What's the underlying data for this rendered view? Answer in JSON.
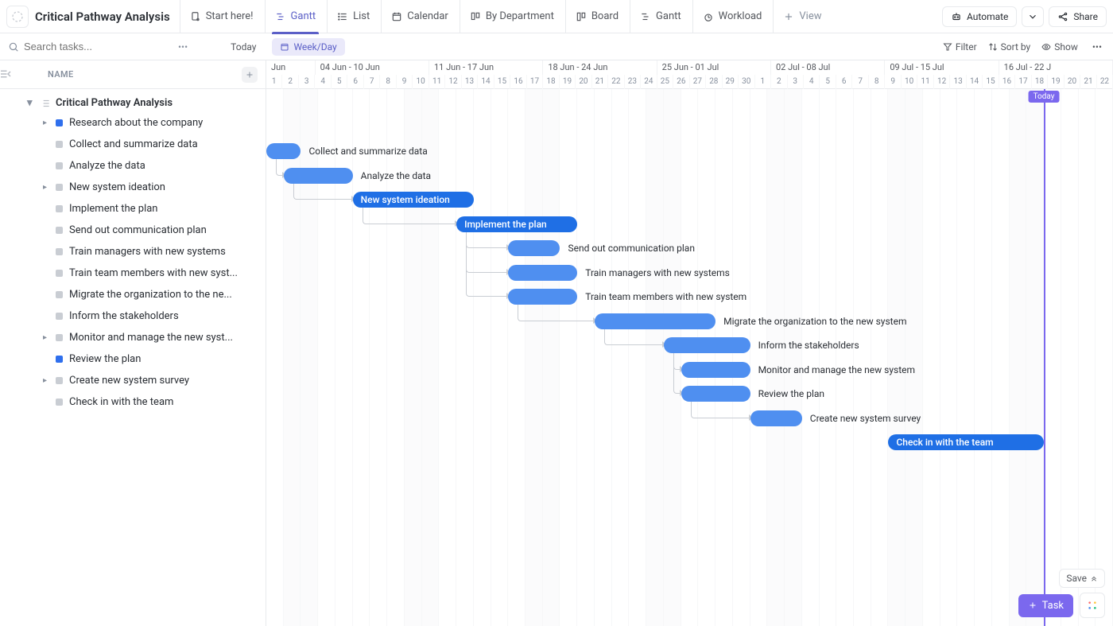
{
  "header": {
    "title": "Critical Pathway Analysis",
    "tabs": [
      {
        "label": "Start here!"
      },
      {
        "label": "Gantt"
      },
      {
        "label": "List"
      },
      {
        "label": "Calendar"
      },
      {
        "label": "By Department"
      },
      {
        "label": "Board"
      },
      {
        "label": "Gantt"
      },
      {
        "label": "Workload"
      }
    ],
    "add_view": "View",
    "automate": "Automate",
    "share": "Share"
  },
  "filter": {
    "search_placeholder": "Search tasks...",
    "today": "Today",
    "weekday": "Week/Day",
    "filter": "Filter",
    "sortby": "Sort by",
    "show": "Show"
  },
  "sidebar": {
    "name_header": "NAME",
    "group": "Critical Pathway Analysis",
    "tasks": [
      {
        "label": "Research about the company",
        "status": "blue",
        "children": true
      },
      {
        "label": "Collect and summarize data",
        "status": "grey",
        "children": false
      },
      {
        "label": "Analyze the data",
        "status": "grey",
        "children": false
      },
      {
        "label": "New system ideation",
        "status": "grey",
        "children": true
      },
      {
        "label": "Implement the plan",
        "status": "grey",
        "children": false
      },
      {
        "label": "Send out communication plan",
        "status": "grey",
        "children": false
      },
      {
        "label": "Train managers with new systems",
        "status": "grey",
        "children": false
      },
      {
        "label": "Train team members with new syst...",
        "status": "grey",
        "children": false
      },
      {
        "label": "Migrate the organization to the ne...",
        "status": "grey",
        "children": false
      },
      {
        "label": "Inform the stakeholders",
        "status": "grey",
        "children": false
      },
      {
        "label": "Monitor and manage the new syst...",
        "status": "grey",
        "children": true
      },
      {
        "label": "Review the plan",
        "status": "blue",
        "children": false
      },
      {
        "label": "Create new system survey",
        "status": "grey",
        "children": true
      },
      {
        "label": "Check in with the team",
        "status": "grey",
        "children": false
      }
    ]
  },
  "timeline": {
    "weeks": [
      {
        "label": "Jun",
        "days": 3
      },
      {
        "label": "04 Jun - 10 Jun",
        "days": 7
      },
      {
        "label": "11 Jun - 17 Jun",
        "days": 7
      },
      {
        "label": "18 Jun - 24 Jun",
        "days": 7
      },
      {
        "label": "25 Jun - 01 Jul",
        "days": 7
      },
      {
        "label": "02 Jul - 08 Jul",
        "days": 7
      },
      {
        "label": "09 Jul - 15 Jul",
        "days": 7
      },
      {
        "label": "16 Jul - 22 J",
        "days": 7
      }
    ],
    "days": [
      1,
      2,
      3,
      4,
      5,
      6,
      7,
      8,
      9,
      10,
      11,
      12,
      13,
      14,
      15,
      16,
      17,
      18,
      19,
      20,
      21,
      22,
      23,
      24,
      25,
      26,
      27,
      28,
      29,
      30,
      1,
      2,
      3,
      4,
      5,
      6,
      7,
      8,
      9,
      10,
      11,
      12,
      13,
      14,
      15,
      16,
      17,
      18,
      19,
      20,
      21,
      22
    ],
    "weekends": [
      2,
      3,
      9,
      10,
      16,
      17,
      23,
      24,
      30,
      31,
      37,
      38,
      44,
      45,
      51,
      52
    ],
    "today_index": 45,
    "today_label": "Today"
  },
  "bars": [
    {
      "row": 0,
      "start": 0,
      "span": 2,
      "label": "Collect and summarize data",
      "inside": false,
      "dark": false,
      "dep_from": null
    },
    {
      "row": 1,
      "start": 1,
      "span": 4,
      "label": "Analyze the data",
      "inside": false,
      "dark": false,
      "dep_from": 0
    },
    {
      "row": 2,
      "start": 5,
      "span": 7,
      "label": "New system ideation",
      "inside": true,
      "dark": true,
      "dep_from": 1
    },
    {
      "row": 3,
      "start": 11,
      "span": 7,
      "label": "Implement the plan",
      "inside": true,
      "dark": true,
      "dep_from": 2
    },
    {
      "row": 4,
      "start": 14,
      "span": 3,
      "label": "Send out communication plan",
      "inside": false,
      "dark": false,
      "dep_from": 3
    },
    {
      "row": 5,
      "start": 14,
      "span": 4,
      "label": "Train managers with new systems",
      "inside": false,
      "dark": false,
      "dep_from": 3
    },
    {
      "row": 6,
      "start": 14,
      "span": 4,
      "label": "Train team members with new system",
      "inside": false,
      "dark": false,
      "dep_from": 3
    },
    {
      "row": 7,
      "start": 19,
      "span": 7,
      "label": "Migrate the organization to the new system",
      "inside": false,
      "dark": false,
      "dep_from": 6
    },
    {
      "row": 8,
      "start": 23,
      "span": 5,
      "label": "Inform the stakeholders",
      "inside": false,
      "dark": false,
      "dep_from": 7
    },
    {
      "row": 9,
      "start": 24,
      "span": 4,
      "label": "Monitor and manage the new system",
      "inside": false,
      "dark": false,
      "dep_from": 8
    },
    {
      "row": 10,
      "start": 24,
      "span": 4,
      "label": "Review the plan",
      "inside": false,
      "dark": false,
      "dep_from": 8
    },
    {
      "row": 11,
      "start": 28,
      "span": 3,
      "label": "Create new system survey",
      "inside": false,
      "dark": false,
      "dep_from": 10
    },
    {
      "row": 12,
      "start": 36,
      "span": 9,
      "label": "Check in with the team",
      "inside": true,
      "dark": true,
      "dep_from": null
    }
  ],
  "bottom": {
    "save": "Save",
    "task": "Task"
  }
}
